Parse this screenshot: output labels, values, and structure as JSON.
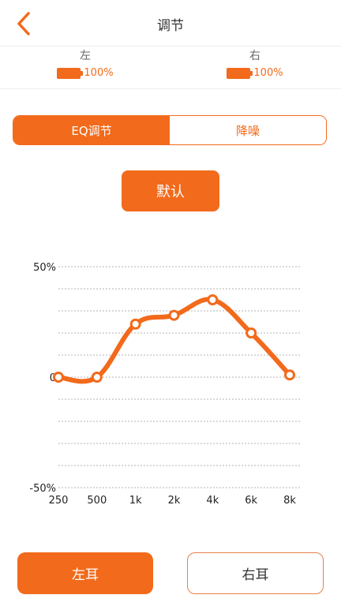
{
  "header": {
    "title": "调节",
    "back_icon": "chevron-left-icon"
  },
  "battery": {
    "left": {
      "label": "左",
      "percent": "100%",
      "level": 1.0
    },
    "right": {
      "label": "右",
      "percent": "100%",
      "level": 1.0
    }
  },
  "tabs": [
    {
      "label": "EQ调节",
      "active": true
    },
    {
      "label": "降噪",
      "active": false
    }
  ],
  "default_button": "默认",
  "chart_data": {
    "type": "line",
    "categories": [
      "250",
      "500",
      "1k",
      "2k",
      "4k",
      "6k",
      "8k"
    ],
    "values": [
      0,
      0,
      24,
      28,
      35,
      20,
      1
    ],
    "y_ticks": [
      "50%",
      "0",
      "-50%"
    ],
    "ylim": [
      -50,
      50
    ],
    "grid": true,
    "color": "#F26A1B"
  },
  "bottom": {
    "left_ear": "左耳",
    "right_ear": "右耳"
  },
  "colors": {
    "accent": "#F26A1B"
  }
}
